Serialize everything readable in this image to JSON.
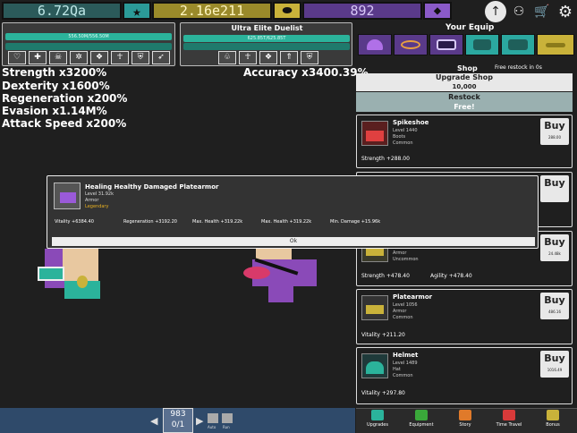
{
  "currencies": {
    "stars": "6.72Qa",
    "coins": "2.16e211",
    "gems": "892"
  },
  "player": {
    "hp_text": "556.50M/556.50M",
    "stats": [
      "Strength x3200%",
      "Dexterity x1600%",
      "Regeneration x200%",
      "Evasion x1.14M%",
      "Attack Speed x200%"
    ]
  },
  "enemy": {
    "title": "Ultra Elite Duelist",
    "hp_text": "625.85T/625.85T",
    "accuracy": "Accuracy x3400.39%"
  },
  "equip": {
    "title": "Your Equip"
  },
  "shop": {
    "title": "Shop",
    "restock_timer": "Free restock in 0s",
    "upgrade_label": "Upgrade Shop",
    "upgrade_cost": "10,000",
    "restock_label": "Restock",
    "restock_cost": "Free!",
    "items": [
      {
        "name": "Spikeshoe",
        "level": "Level 1440",
        "type": "Boots",
        "rarity": "Common",
        "stat": "Strength +288.00",
        "buy": "Buy",
        "price": "288.00"
      },
      {
        "name": "",
        "level": "",
        "type": "",
        "rarity": "",
        "stat": "",
        "buy": "Buy",
        "price": ""
      },
      {
        "name": "",
        "level": "",
        "type": "Armor",
        "rarity": "Uncommon",
        "stat": "Strength +478.40",
        "stat2": "Agility +478.40",
        "buy": "Buy",
        "price": "24.48k"
      },
      {
        "name": "Platearmor",
        "level": "Level 1056",
        "type": "Armor",
        "rarity": "Common",
        "stat": "Vitality +211.20",
        "buy": "Buy",
        "price": "486.16"
      },
      {
        "name": "Helmet",
        "level": "Level 1489",
        "type": "Hat",
        "rarity": "Common",
        "stat": "Vitality +297.80",
        "buy": "Buy",
        "price": "1016.49"
      }
    ]
  },
  "popup": {
    "name": "Healing Healthy Damaged Platearmor",
    "level": "Level 31.92k",
    "type": "Armor",
    "rarity": "Legendary",
    "stats": [
      "Vitality +6384.40",
      "Regeneration +3192.20",
      "Max. Health +319.22k",
      "Max. Health +319.22k",
      "Min. Damage +15.96k"
    ],
    "ok": "Ok"
  },
  "pager": {
    "current": "983",
    "fraction": "0/1",
    "auto": "Auto",
    "run": "Run"
  },
  "nav": [
    {
      "label": "Upgrades",
      "color": "#2bb39b"
    },
    {
      "label": "Equipment",
      "color": "#3aa83a"
    },
    {
      "label": "Story",
      "color": "#e07a2a"
    },
    {
      "label": "Time Travel",
      "color": "#d83a3a"
    },
    {
      "label": "Bonus",
      "color": "#c9b23a"
    }
  ],
  "colors": {
    "teal": "#2bb39b",
    "gold": "#c9b23a",
    "purple": "#5a3a8a",
    "bg": "#1f1f1f"
  }
}
